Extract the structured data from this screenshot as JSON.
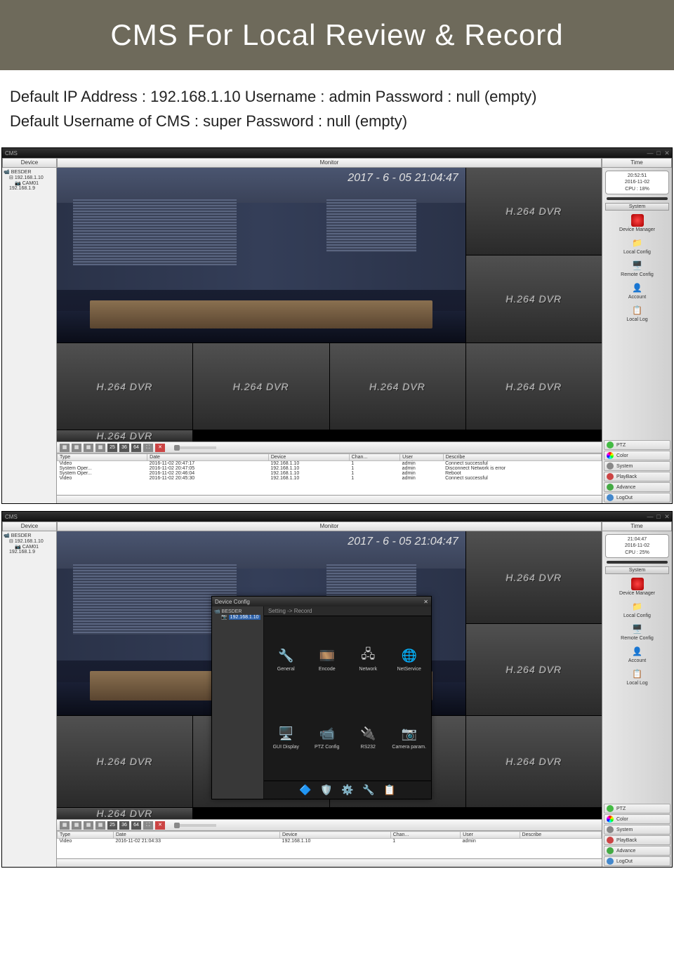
{
  "banner": {
    "title": "CMS For Local Review & Record"
  },
  "creds": {
    "line1": "Default IP Address : 192.168.1.10  Username : admin Password : null (empty)",
    "line2": "Default Username of CMS : super Password : null (empty)"
  },
  "app": {
    "title": "CMS",
    "headers": {
      "device": "Device",
      "monitor": "Monitor",
      "time": "Time"
    },
    "tree": {
      "root": "BESDER",
      "ip1": "192.168.1.10",
      "cam": "CAM01",
      "ip2": "192.168.1.9"
    },
    "timestamp": "2017 - 6 - 05  21:04:47",
    "dvr": "H.264 DVR",
    "gridnums": [
      "25",
      "36",
      "64"
    ],
    "clock1": {
      "time": "20:52:51",
      "date": "2016-11-02",
      "cpu": "CPU : 18%"
    },
    "clock2": {
      "time": "21:04:47",
      "date": "2016-11-02",
      "cpu": "CPU : 25%"
    },
    "rpanel": {
      "system_hdr": "System",
      "items": [
        "Device Manager",
        "Local Config",
        "Remote Config",
        "Account",
        "Local Log"
      ],
      "btns": [
        "PTZ",
        "Color",
        "System",
        "PlayBack",
        "Advance",
        "LogOut"
      ]
    },
    "log": {
      "cols": [
        "Type",
        "Date",
        "Device",
        "Chan...",
        "User",
        "Describe"
      ],
      "rows1": [
        [
          "Video",
          "2016-11-02 20:47:17",
          "192.168.1.10",
          "1",
          "admin",
          "Connect successful"
        ],
        [
          "System Oper...",
          "2016-11-02 20:47:05",
          "192.168.1.10",
          "1",
          "admin",
          "Disconnect Network is error"
        ],
        [
          "System Oper...",
          "2016-11-02 20:46:04",
          "192.168.1.10",
          "1",
          "admin",
          "Reboot"
        ],
        [
          "Video",
          "2016-11-02 20:45:30",
          "192.168.1.10",
          "1",
          "admin",
          "Connect successful"
        ]
      ],
      "rows2": [
        [
          "Video",
          "2016-11-02 21:04:33",
          "192.168.1.10",
          "1",
          "admin",
          ""
        ]
      ]
    }
  },
  "overlay": {
    "title": "Device Config",
    "tree_root": "BESDER",
    "tree_sel": "192.168.1.10",
    "breadcrumb": "Setting -> Record",
    "items": [
      "General",
      "Encode",
      "Network",
      "NetService",
      "GUI Display",
      "PTZ Config",
      "RS232",
      "Camera param."
    ]
  }
}
